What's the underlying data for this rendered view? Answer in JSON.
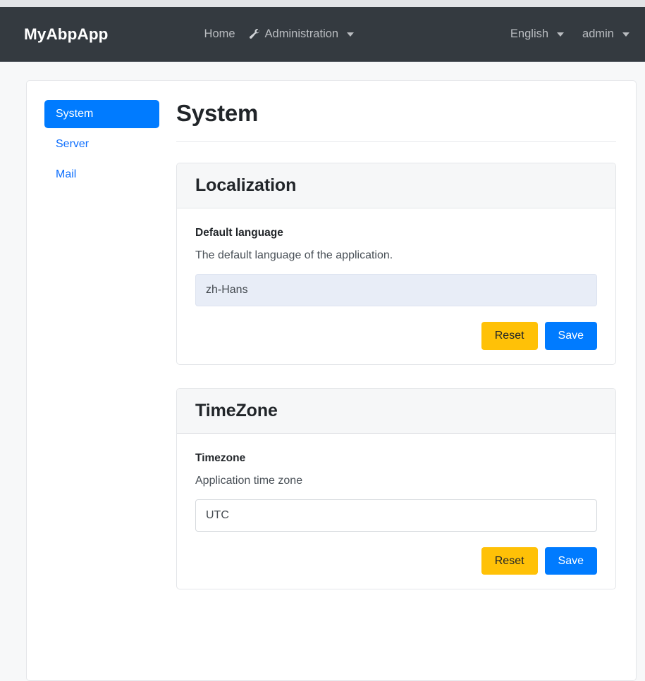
{
  "navbar": {
    "brand": "MyAbpApp",
    "home_label": "Home",
    "administration_label": "Administration",
    "administration_icon": "wrench-icon",
    "language_label": "English",
    "user_label": "admin"
  },
  "sidebar": {
    "items": [
      {
        "label": "System",
        "active": true
      },
      {
        "label": "Server",
        "active": false
      },
      {
        "label": "Mail",
        "active": false
      }
    ]
  },
  "main": {
    "page_title": "System",
    "cards": [
      {
        "header": "Localization",
        "field_label": "Default language",
        "field_desc": "The default language of the application.",
        "field_value": "zh-Hans",
        "field_highlighted": true,
        "reset_label": "Reset",
        "save_label": "Save"
      },
      {
        "header": "TimeZone",
        "field_label": "Timezone",
        "field_desc": "Application time zone",
        "field_value": "UTC",
        "field_highlighted": false,
        "reset_label": "Reset",
        "save_label": "Save"
      }
    ]
  },
  "colors": {
    "navbar_bg": "#343a40",
    "primary": "#007bff",
    "warning": "#ffc107",
    "link": "#0d6efd",
    "highlight_field_bg": "#e8edf7"
  }
}
